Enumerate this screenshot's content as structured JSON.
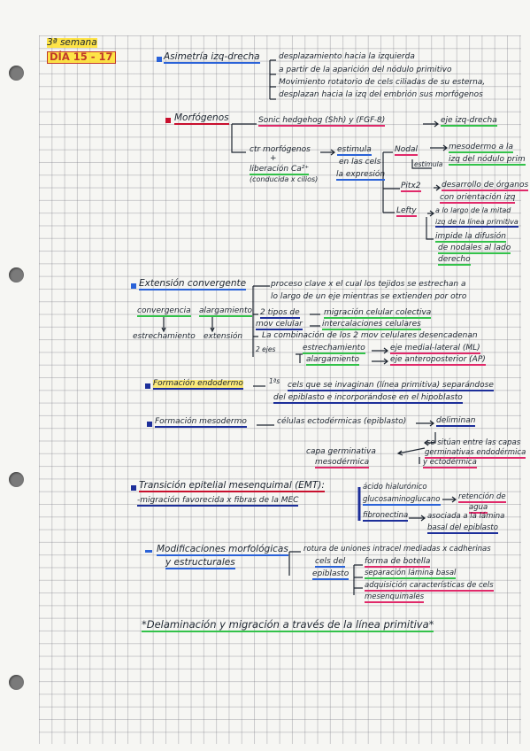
{
  "header": {
    "week": "3ª semana",
    "days": "DÍA 15 - 17"
  },
  "sec1": {
    "title": "Asimetría izq-drecha",
    "l1": "desplazamiento hacia la izquierda",
    "l2": "a partir de la aparición del nódulo primitivo",
    "l3": "Movimiento rotatorio de cels ciliadas de su esterna,",
    "l4": "desplazan hacia la izq del embrión sus morfógenos"
  },
  "sec2": {
    "title": "Morfógenos",
    "sonic": "Sonic hedgehog (Shh) y (FGF-8)",
    "eje": "eje izq-drecha",
    "ctr": "ctr morfógenos",
    "plus": "+",
    "liberacion": "liberación Ca²⁺",
    "liberacion2": "(conducida x cilios)",
    "estimula": "estimula",
    "estimula2": "en las cels",
    "estimula3": "la expresión",
    "nodal": "Nodal",
    "nodal_estimula": "estimula",
    "nodal_r1": "mesodermo a la",
    "nodal_r2": "izq del nódulo prim",
    "pitx2": "Pitx2",
    "pitx2_r1": "desarrollo de órganos",
    "pitx2_r2": "con orientación izq",
    "lefty": "Lefty",
    "lefty_r1": "a lo largo de la mitad",
    "lefty_r2": "izq de la línea primitiva",
    "lefty_r3": "impide la difusión",
    "lefty_r4": "de nodales al lado",
    "lefty_r5": "derecho"
  },
  "sec3": {
    "title": "Extensión convergente",
    "conv": "convergencia",
    "alarg": "alargamiento",
    "estr": "estrechamiento",
    "ext": "extensión",
    "p1": "proceso clave x el cual los tejidos se estrechan a",
    "p2": "lo largo de un eje mientras se extienden por otro",
    "tipos1": "2 tipos de",
    "tipos2": "mov celular",
    "mig": "migración celular colectiva",
    "inter": "intercalaciones celulares",
    "comb": "La combinación de los 2 mov celulares desencadenan",
    "dos_ejes": "2 ejes",
    "estrech": "estrechamiento",
    "eje_ml": "eje medial-lateral (ML)",
    "alarg2": "alargamiento",
    "eje_ap": "eje anteroposterior (AP)"
  },
  "sec4": {
    "title": "Formación endodermo",
    "primeras": "1ªs",
    "e1": "cels que se invaginan (línea primitiva) separándose",
    "e2": "del epiblasto e incorporándose en el hipoblasto"
  },
  "sec5": {
    "title": "Formación mesodermo",
    "cels": "células ectodérmicas (epiblasto)",
    "deliminan": "deliminan",
    "situan1": "se sitúan entre las capas",
    "situan2": "germinativas endodérmica",
    "situan3": "y ectodérmica",
    "capa1": "capa germinativa",
    "capa2": "mesodérmica"
  },
  "sec6": {
    "title": "Transición epitelial mesenquimal (EMT):",
    "mig": "-migración favorecida x fibras de la MEC",
    "acido1": "ácido hialurónico",
    "acido2": "glucosaminoglucano",
    "retencion1": "retención de",
    "retencion2": "agua",
    "fibro": "fibronectina",
    "asociada1": "asociada a la lámina",
    "asociada2": "basal del epiblasto"
  },
  "sec7": {
    "title1": "Modificaciones morfológicas",
    "title2": "y estructurales",
    "r1": "rotura de uniones intracel mediadas x cadherinas",
    "cels1": "cels del",
    "cels2": "epiblasto",
    "forma": "forma de botella",
    "sep": "separación lámina basal",
    "adq1": "adquisición características de cels",
    "adq2": "mesenquimales"
  },
  "footer": {
    "text": "*Delaminación y migración a través de la línea primitiva*"
  }
}
